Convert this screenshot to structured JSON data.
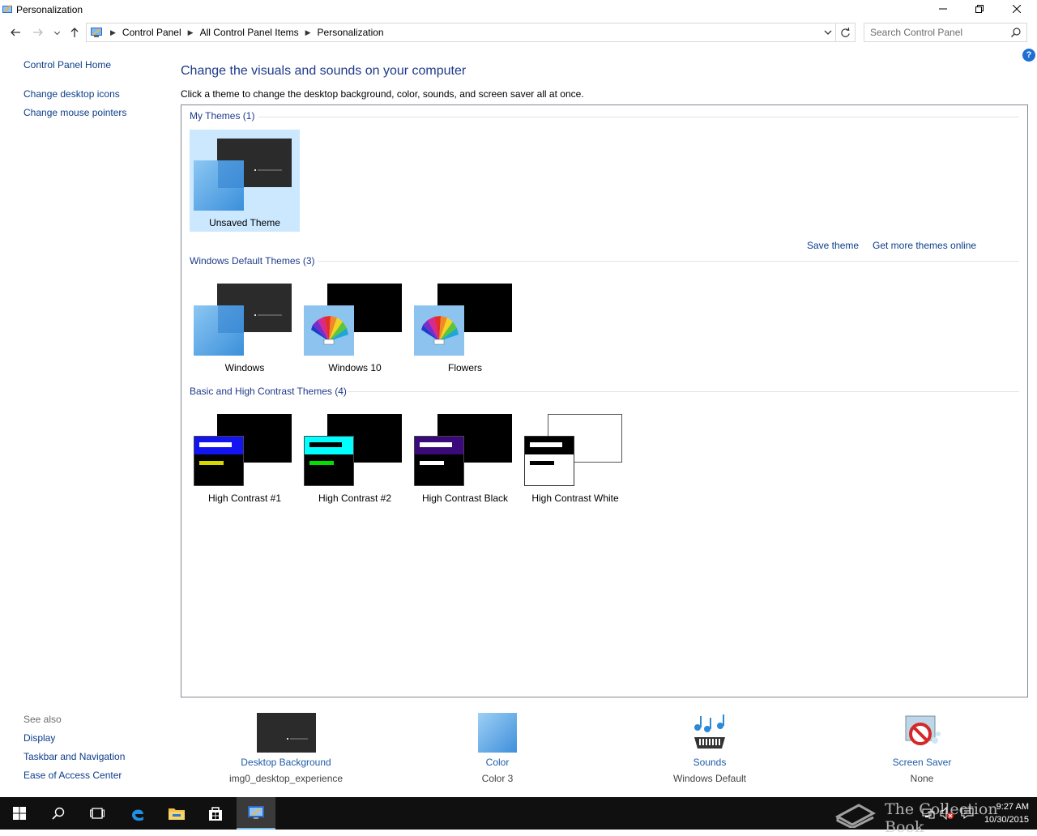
{
  "window": {
    "title": "Personalization"
  },
  "address": {
    "crumbs": [
      "Control Panel",
      "All Control Panel Items",
      "Personalization"
    ],
    "search_placeholder": "Search Control Panel"
  },
  "leftnav": {
    "home": "Control Panel Home",
    "links": [
      "Change desktop icons",
      "Change mouse pointers"
    ]
  },
  "seealso": {
    "title": "See also",
    "links": [
      "Display",
      "Taskbar and Navigation",
      "Ease of Access Center"
    ]
  },
  "main": {
    "heading": "Change the visuals and sounds on your computer",
    "subheading": "Click a theme to change the desktop background, color, sounds, and screen saver all at once.",
    "save_theme": "Save theme",
    "more_themes": "Get more themes online",
    "groups": [
      {
        "title": "My Themes (1)",
        "themes": [
          "Unsaved Theme"
        ]
      },
      {
        "title": "Windows Default Themes (3)",
        "themes": [
          "Windows",
          "Windows 10",
          "Flowers"
        ]
      },
      {
        "title": "Basic and High Contrast Themes (4)",
        "themes": [
          "High Contrast #1",
          "High Contrast #2",
          "High Contrast Black",
          "High Contrast White"
        ]
      }
    ],
    "selected_theme": "Unsaved Theme"
  },
  "bottom": {
    "background": {
      "label": "Desktop Background",
      "value": "img0_desktop_experience"
    },
    "color": {
      "label": "Color",
      "value": "Color 3"
    },
    "sounds": {
      "label": "Sounds",
      "value": "Windows Default"
    },
    "screensaver": {
      "label": "Screen Saver",
      "value": "None"
    }
  },
  "taskbar": {
    "time": "9:27 AM",
    "date": "10/30/2015",
    "watermark": "The Collection Book"
  },
  "colors": {
    "link": "#0c3d8a",
    "heading": "#1e3a8a",
    "selected_bg": "#cce8ff",
    "taskbar": "#101010",
    "accent_blue": "#4a9de0"
  }
}
